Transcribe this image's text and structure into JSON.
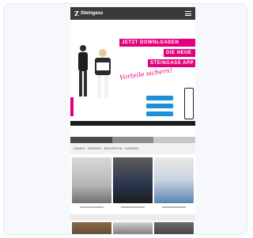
{
  "header": {
    "logo_text": "Steingass",
    "menu_icon": "hamburger-menu-icon"
  },
  "hero": {
    "banner_line1": "JETZT DOWNLOADEN",
    "banner_line2": "DIE NEUE",
    "banner_line3": "STEINGASS APP",
    "script_text": "Vorteile sichern!"
  },
  "category": {
    "label": "DAMEN · HERREN · NEUHEITEN · MARKEN"
  },
  "colors": {
    "brand_pink": "#e4007c",
    "badge_blue": "#1e90d6",
    "topbar": "#3a3a3a"
  }
}
